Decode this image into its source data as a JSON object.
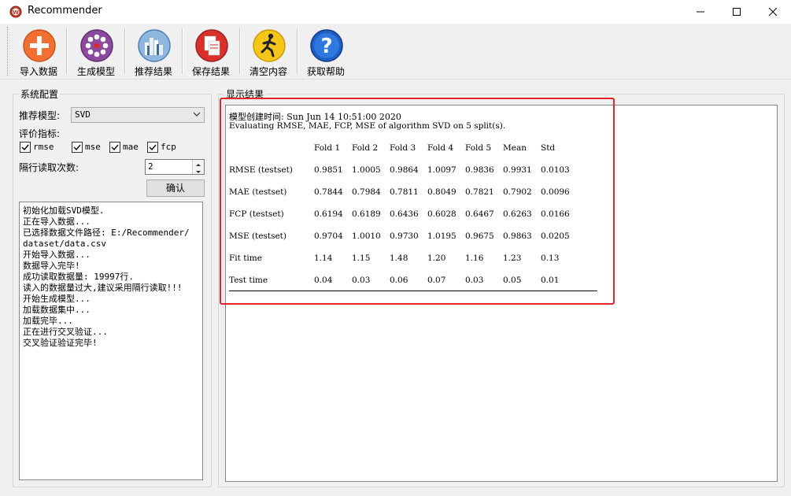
{
  "window": {
    "title": "Recommender"
  },
  "toolbar": {
    "import_label": "导入数据",
    "model_label": "生成模型",
    "recommend_label": "推荐结果",
    "save_label": "保存结果",
    "clear_label": "清空内容",
    "help_label": "获取帮助"
  },
  "config": {
    "group_title": "系统配置",
    "model_label": "推荐模型:",
    "model_value": "SVD",
    "metrics_label": "评价指标:",
    "metrics": [
      {
        "name": "rmse",
        "checked": true
      },
      {
        "name": "mse",
        "checked": true
      },
      {
        "name": "mae",
        "checked": true
      },
      {
        "name": "fcp",
        "checked": true
      }
    ],
    "interval_label": "隔行读取次数:",
    "interval_value": "2",
    "confirm_label": "确认"
  },
  "log": [
    "初始化加载SVD模型.",
    "正在导入数据...",
    "已选择数据文件路径: E:/Recommender/",
    "dataset/data.csv",
    "开始导入数据...",
    "数据导入完毕!",
    "成功读取数据量: 19997行.",
    "读入的数据量过大,建议采用隔行读取!!!",
    "开始生成模型...",
    "加载数据集中...",
    "加载完毕...",
    "正在进行交叉验证...",
    "交叉验证验证完毕!"
  ],
  "result": {
    "group_title": "显示结果",
    "line1": "模型创建时间: Sun Jun 14 10:51:00 2020",
    "line2": "Evaluating RMSE, MAE, FCP, MSE of algorithm SVD on 5 split(s).",
    "headers": [
      "Fold 1",
      "Fold 2",
      "Fold 3",
      "Fold 4",
      "Fold 5",
      "Mean",
      "Std"
    ],
    "rows": [
      {
        "label": "RMSE (testset)",
        "values": [
          "0.9851",
          "1.0005",
          "0.9864",
          "1.0097",
          "0.9836",
          "0.9931",
          "0.0103"
        ]
      },
      {
        "label": "MAE (testset)",
        "values": [
          "0.7844",
          "0.7984",
          "0.7811",
          "0.8049",
          "0.7821",
          "0.7902",
          "0.0096"
        ]
      },
      {
        "label": "FCP (testset)",
        "values": [
          "0.6194",
          "0.6189",
          "0.6436",
          "0.6028",
          "0.6467",
          "0.6263",
          "0.0166"
        ]
      },
      {
        "label": "MSE (testset)",
        "values": [
          "0.9704",
          "1.0010",
          "0.9730",
          "1.0195",
          "0.9675",
          "0.9863",
          "0.0205"
        ]
      },
      {
        "label": "Fit time",
        "values": [
          "1.14",
          "1.15",
          "1.48",
          "1.20",
          "1.16",
          "1.23",
          "0.13"
        ]
      },
      {
        "label": "Test time",
        "values": [
          "0.04",
          "0.03",
          "0.06",
          "0.07",
          "0.03",
          "0.05",
          "0.01"
        ]
      }
    ]
  },
  "colors": {
    "highlight": "#e5242a"
  }
}
